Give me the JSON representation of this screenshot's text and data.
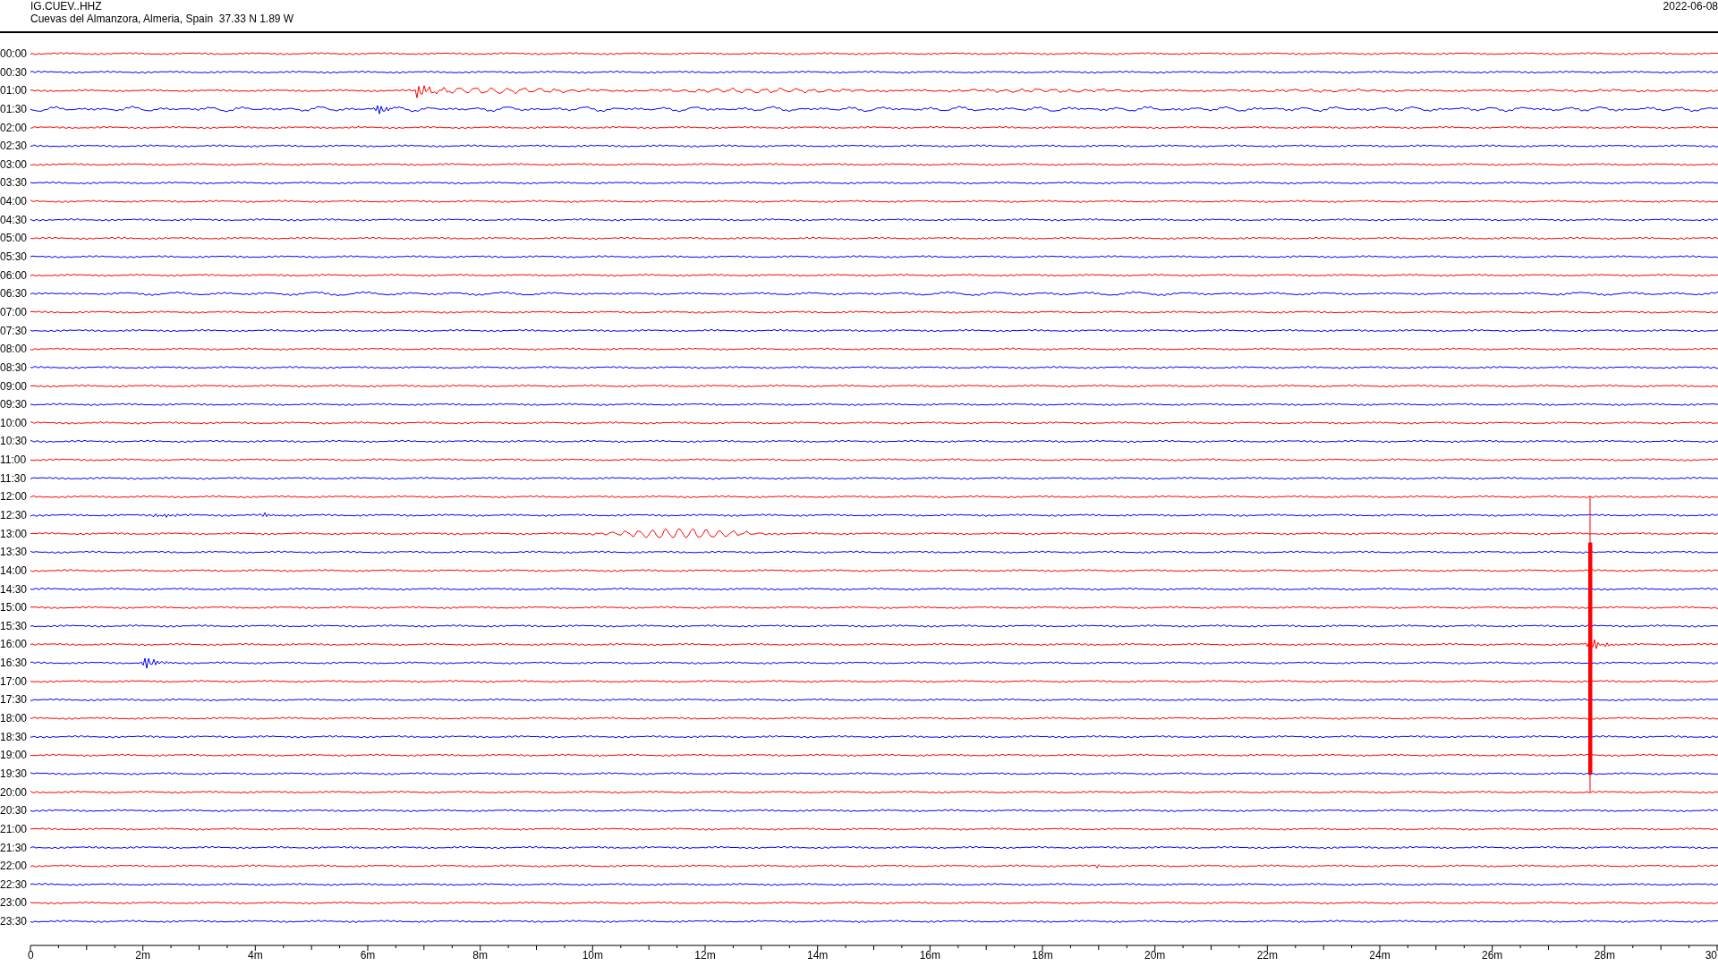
{
  "station": {
    "code": "IG.CUEV..HHZ",
    "location": "Cuevas del Almanzora, Almeria, Spain  37.33 N 1.89 W",
    "date": "2022-06-08"
  },
  "traces": [
    {
      "label": "00:00",
      "color": "#ff0000"
    },
    {
      "label": "00:30",
      "color": "#0000ff"
    },
    {
      "label": "01:00",
      "color": "#ff0000"
    },
    {
      "label": "01:30",
      "color": "#0000ff"
    },
    {
      "label": "02:00",
      "color": "#ff0000"
    },
    {
      "label": "02:30",
      "color": "#0000ff"
    },
    {
      "label": "03:00",
      "color": "#ff0000"
    },
    {
      "label": "03:30",
      "color": "#0000ff"
    },
    {
      "label": "04:00",
      "color": "#ff0000"
    },
    {
      "label": "04:30",
      "color": "#0000ff"
    },
    {
      "label": "05:00",
      "color": "#ff0000"
    },
    {
      "label": "05:30",
      "color": "#0000ff"
    },
    {
      "label": "06:00",
      "color": "#ff0000"
    },
    {
      "label": "06:30",
      "color": "#0000ff"
    },
    {
      "label": "07:00",
      "color": "#ff0000"
    },
    {
      "label": "07:30",
      "color": "#0000ff"
    },
    {
      "label": "08:00",
      "color": "#ff0000"
    },
    {
      "label": "08:30",
      "color": "#0000ff"
    },
    {
      "label": "09:00",
      "color": "#ff0000"
    },
    {
      "label": "09:30",
      "color": "#0000ff"
    },
    {
      "label": "10:00",
      "color": "#ff0000"
    },
    {
      "label": "10:30",
      "color": "#0000ff"
    },
    {
      "label": "11:00",
      "color": "#ff0000"
    },
    {
      "label": "11:30",
      "color": "#0000ff"
    },
    {
      "label": "12:00",
      "color": "#ff0000"
    },
    {
      "label": "12:30",
      "color": "#0000ff"
    },
    {
      "label": "13:00",
      "color": "#ff0000"
    },
    {
      "label": "13:30",
      "color": "#0000ff"
    },
    {
      "label": "14:00",
      "color": "#ff0000"
    },
    {
      "label": "14:30",
      "color": "#0000ff"
    },
    {
      "label": "15:00",
      "color": "#ff0000"
    },
    {
      "label": "15:30",
      "color": "#0000ff"
    },
    {
      "label": "16:00",
      "color": "#ff0000"
    },
    {
      "label": "16:30",
      "color": "#0000ff"
    },
    {
      "label": "17:00",
      "color": "#ff0000"
    },
    {
      "label": "17:30",
      "color": "#0000ff"
    },
    {
      "label": "18:00",
      "color": "#ff0000"
    },
    {
      "label": "18:30",
      "color": "#0000ff"
    },
    {
      "label": "19:00",
      "color": "#ff0000"
    },
    {
      "label": "19:30",
      "color": "#0000ff"
    },
    {
      "label": "20:00",
      "color": "#ff0000"
    },
    {
      "label": "20:30",
      "color": "#0000ff"
    },
    {
      "label": "21:00",
      "color": "#ff0000"
    },
    {
      "label": "21:30",
      "color": "#0000ff"
    },
    {
      "label": "22:00",
      "color": "#ff0000"
    },
    {
      "label": "22:30",
      "color": "#0000ff"
    },
    {
      "label": "23:00",
      "color": "#ff0000"
    },
    {
      "label": "23:30",
      "color": "#0000ff"
    }
  ],
  "axis": {
    "ticks": [
      "0",
      "2m",
      "4m",
      "6m",
      "8m",
      "10m",
      "12m",
      "14m",
      "16m",
      "18m",
      "20m",
      "22m",
      "24m",
      "26m",
      "28m",
      "30"
    ]
  }
}
